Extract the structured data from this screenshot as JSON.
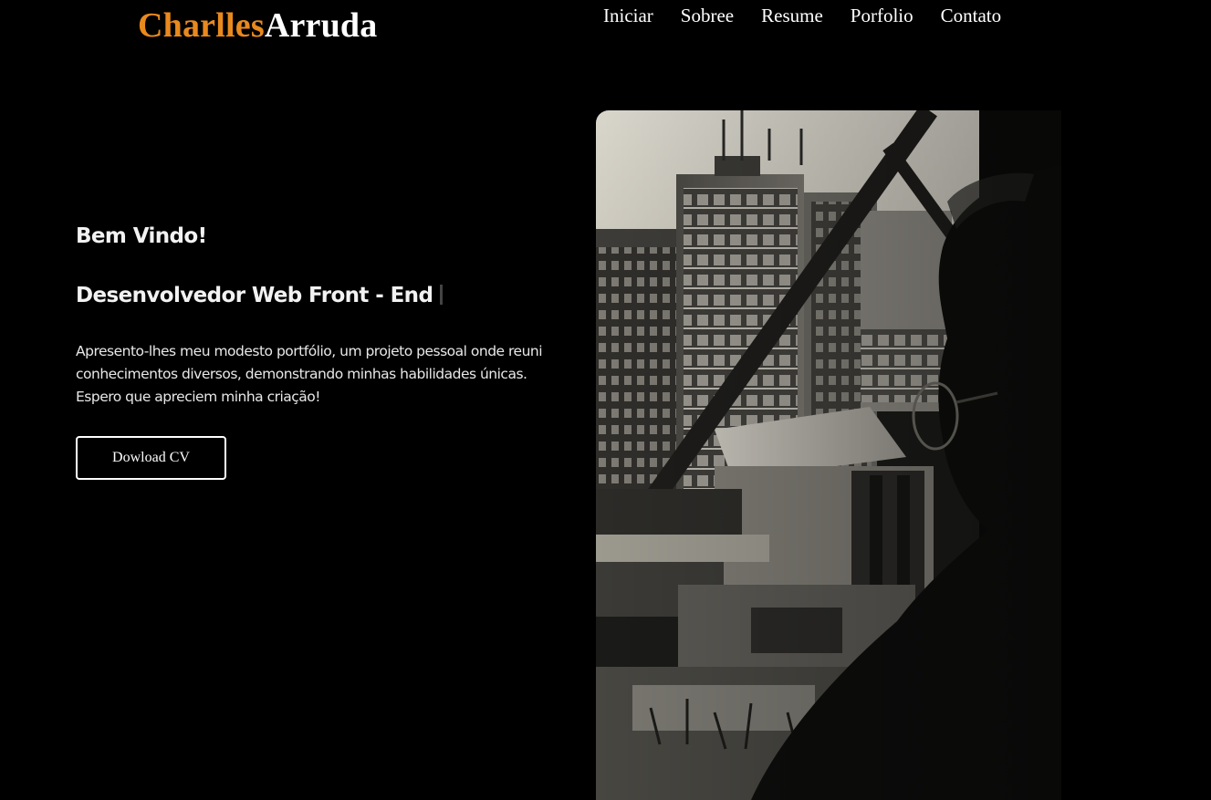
{
  "header": {
    "logo_first": "Charlles",
    "logo_last": "Arruda",
    "nav": [
      {
        "label": "Iniciar"
      },
      {
        "label": "Sobree"
      },
      {
        "label": "Resume"
      },
      {
        "label": "Porfolio"
      },
      {
        "label": "Contato"
      }
    ]
  },
  "hero": {
    "welcome": "Bem Vindo!",
    "role": "Desenvolvedor Web Front - End",
    "intro": "Apresento-lhes meu modesto portfólio, um projeto pessoal onde reuni conhecimentos diversos, demonstrando minhas habilidades únicas. Espero que apreciem minha criação!",
    "cv_button": "Dowload CV"
  },
  "colors": {
    "accent": "#e8891e",
    "background": "#000000",
    "text": "#ffffff"
  }
}
